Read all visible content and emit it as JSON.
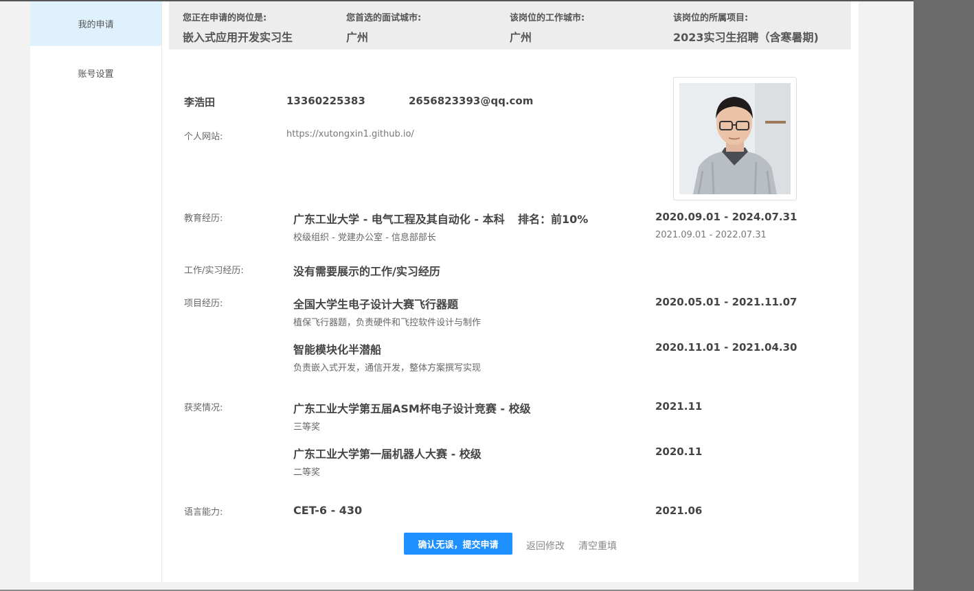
{
  "sidebar": {
    "items": [
      {
        "label": "我的申请"
      },
      {
        "label": "账号设置"
      }
    ]
  },
  "job_info": {
    "position": {
      "label": "您正在申请的岗位是:",
      "value": "嵌入式应用开发实习生"
    },
    "interview_city": {
      "label": "您首选的面试城市:",
      "value": "广州"
    },
    "work_city": {
      "label": "该岗位的工作城市:",
      "value": "广州"
    },
    "project": {
      "label": "该岗位的所属项目:",
      "value": "2023实习生招聘（含寒暑期)"
    }
  },
  "profile": {
    "name": "李浩田",
    "phone": "13360225383",
    "email": "2656823393@qq.com",
    "website_label": "个人网站:",
    "website": "https://xutongxin1.github.io/"
  },
  "education": {
    "label": "教育经历:",
    "school": "广东工业大学 - 电气工程及其自动化 - 本科",
    "rank": "排名：前10%",
    "date": "2020.09.01 - 2024.07.31",
    "org": "校级组织 - 党建办公室 - 信息部部长",
    "org_date": "2021.09.01 - 2022.07.31"
  },
  "work": {
    "label": "工作/实习经历:",
    "value": "没有需要展示的工作/实习经历"
  },
  "projects": {
    "label": "项目经历:",
    "items": [
      {
        "title": "全国大学生电子设计大赛飞行器题",
        "date": "2020.05.01 - 2021.11.07",
        "desc": "植保飞行器题，负责硬件和飞控软件设计与制作"
      },
      {
        "title": "智能模块化半潜船",
        "date": "2020.11.01 - 2021.04.30",
        "desc": "负责嵌入式开发，通信开发，整体方案撰写实现"
      }
    ]
  },
  "awards": {
    "label": "获奖情况:",
    "items": [
      {
        "title": "广东工业大学第五届ASM杯电子设计竞赛 - 校级",
        "date": "2021.11",
        "desc": "三等奖"
      },
      {
        "title": "广东工业大学第一届机器人大赛 - 校级",
        "date": "2020.11",
        "desc": "二等奖"
      }
    ]
  },
  "language": {
    "label": "语言能力:",
    "value": "CET-6 - 430",
    "date": "2021.06"
  },
  "actions": {
    "submit": "确认无误，提交申请",
    "back": "返回修改",
    "reset": "清空重填"
  },
  "colors": {
    "primary": "#1e90ff",
    "sidebar_active": "#dff1fd",
    "info_bar": "#ededed"
  }
}
